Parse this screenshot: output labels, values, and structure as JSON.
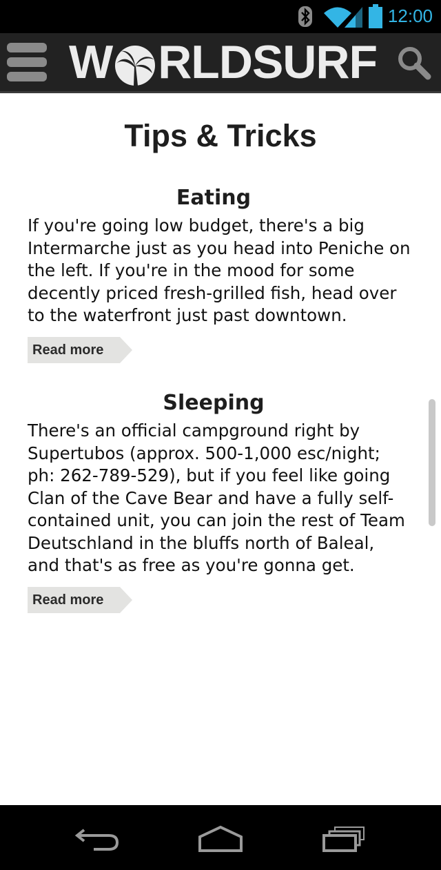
{
  "status_bar": {
    "time": "12:00",
    "icons": [
      "bluetooth-icon",
      "wifi-icon",
      "signal-icon",
      "battery-icon"
    ],
    "accent_color": "#33b5e5"
  },
  "header": {
    "logo_text_left": "W",
    "logo_text_right": "RLDSURF",
    "menu_icon": "hamburger-menu-icon",
    "search_icon": "search-icon"
  },
  "page": {
    "title": "Tips & Tricks"
  },
  "tips": [
    {
      "heading": "Eating",
      "body": "If you're going low budget, there's a big Intermarche just as you head into Peniche on the left. If you're in the mood for some decently priced fresh-grilled fish, head over to the waterfront just past downtown.",
      "link": "Read more"
    },
    {
      "heading": "Sleeping",
      "body": "There's an official campground right by Supertubos (approx. 500-1,000 esc/night; ph: 262-789-529), but if you feel like going Clan of the Cave Bear and have a fully self-contained unit, you can join the rest of Team Deutschland in the bluffs north of Baleal, and that's as free as you're gonna get.",
      "link": "Read more"
    }
  ],
  "nav_bar": {
    "buttons": [
      "back-icon",
      "home-icon",
      "recent-apps-icon"
    ]
  }
}
